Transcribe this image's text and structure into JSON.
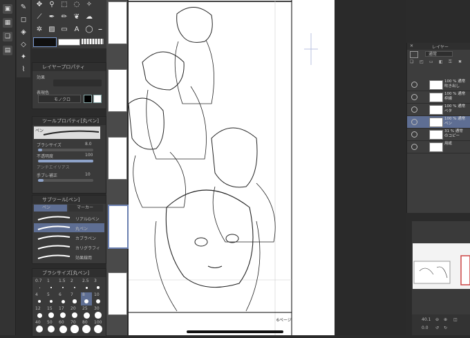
{
  "tool_property": {
    "panel_title": "レイヤープロパティ",
    "effect_label": "効果",
    "expression_color_label": "表現色",
    "expression_color_value": "モノクロ"
  },
  "subtool_detail": {
    "panel_title": "ツールプロパティ[丸ペン]",
    "tool_name": "ペン",
    "brush_size_label": "ブラシサイズ",
    "brush_size_value": "8.0",
    "opacity_label": "不透明度",
    "opacity_value": "100",
    "antialias_label": "アンチエイリアス",
    "stabilization_label": "手ブレ補正",
    "stabilization_value": "10",
    "brush_size_fill": 0.08,
    "opacity_fill": 1.0,
    "stabilization_fill": 0.1
  },
  "subtool_panel": {
    "panel_title": "サブツール[ペン]",
    "tabs": [
      "ペン",
      "マーカー"
    ],
    "items": [
      {
        "label": "リアルGペン",
        "selected": false
      },
      {
        "label": "丸ペン",
        "selected": true
      },
      {
        "label": "カブラペン",
        "selected": false
      },
      {
        "label": "カリグラフィ",
        "selected": false
      },
      {
        "label": "効果線用",
        "selected": false
      }
    ]
  },
  "brush_size_panel": {
    "panel_title": "ブラシサイズ[丸ペン]",
    "sizes": [
      "0.7",
      "1",
      "1.5",
      "2",
      "2.5",
      "3",
      "4",
      "5",
      "6",
      "7",
      "8",
      "10",
      "12",
      "15",
      "17",
      "20",
      "25",
      "30",
      "40",
      "50",
      "60",
      "70",
      "80",
      "100"
    ],
    "selected_size": "8"
  },
  "layer_panel": {
    "title": "レイヤー",
    "blend_mode": "通常",
    "layers": [
      {
        "name": "100 % 通常\n吹き出し",
        "selected": false
      },
      {
        "name": "100 % 通常\n枠線",
        "selected": false
      },
      {
        "name": "100 % 通常\nベタ",
        "selected": false
      },
      {
        "name": "100 % 通常\nペン",
        "selected": true
      },
      {
        "name": "31 % 通常\nのコピー",
        "selected": false
      },
      {
        "name": "用紙",
        "selected": false
      }
    ]
  },
  "navigator": {
    "zoom": "40.1",
    "rotation": "0.0"
  },
  "canvas": {
    "page_label": "6ページ"
  },
  "colors": {
    "accent": "#8ea3c9",
    "selected_row": "#5e6e93",
    "panel_bg": "#3a3a3a",
    "canvas": "#ffffff"
  }
}
